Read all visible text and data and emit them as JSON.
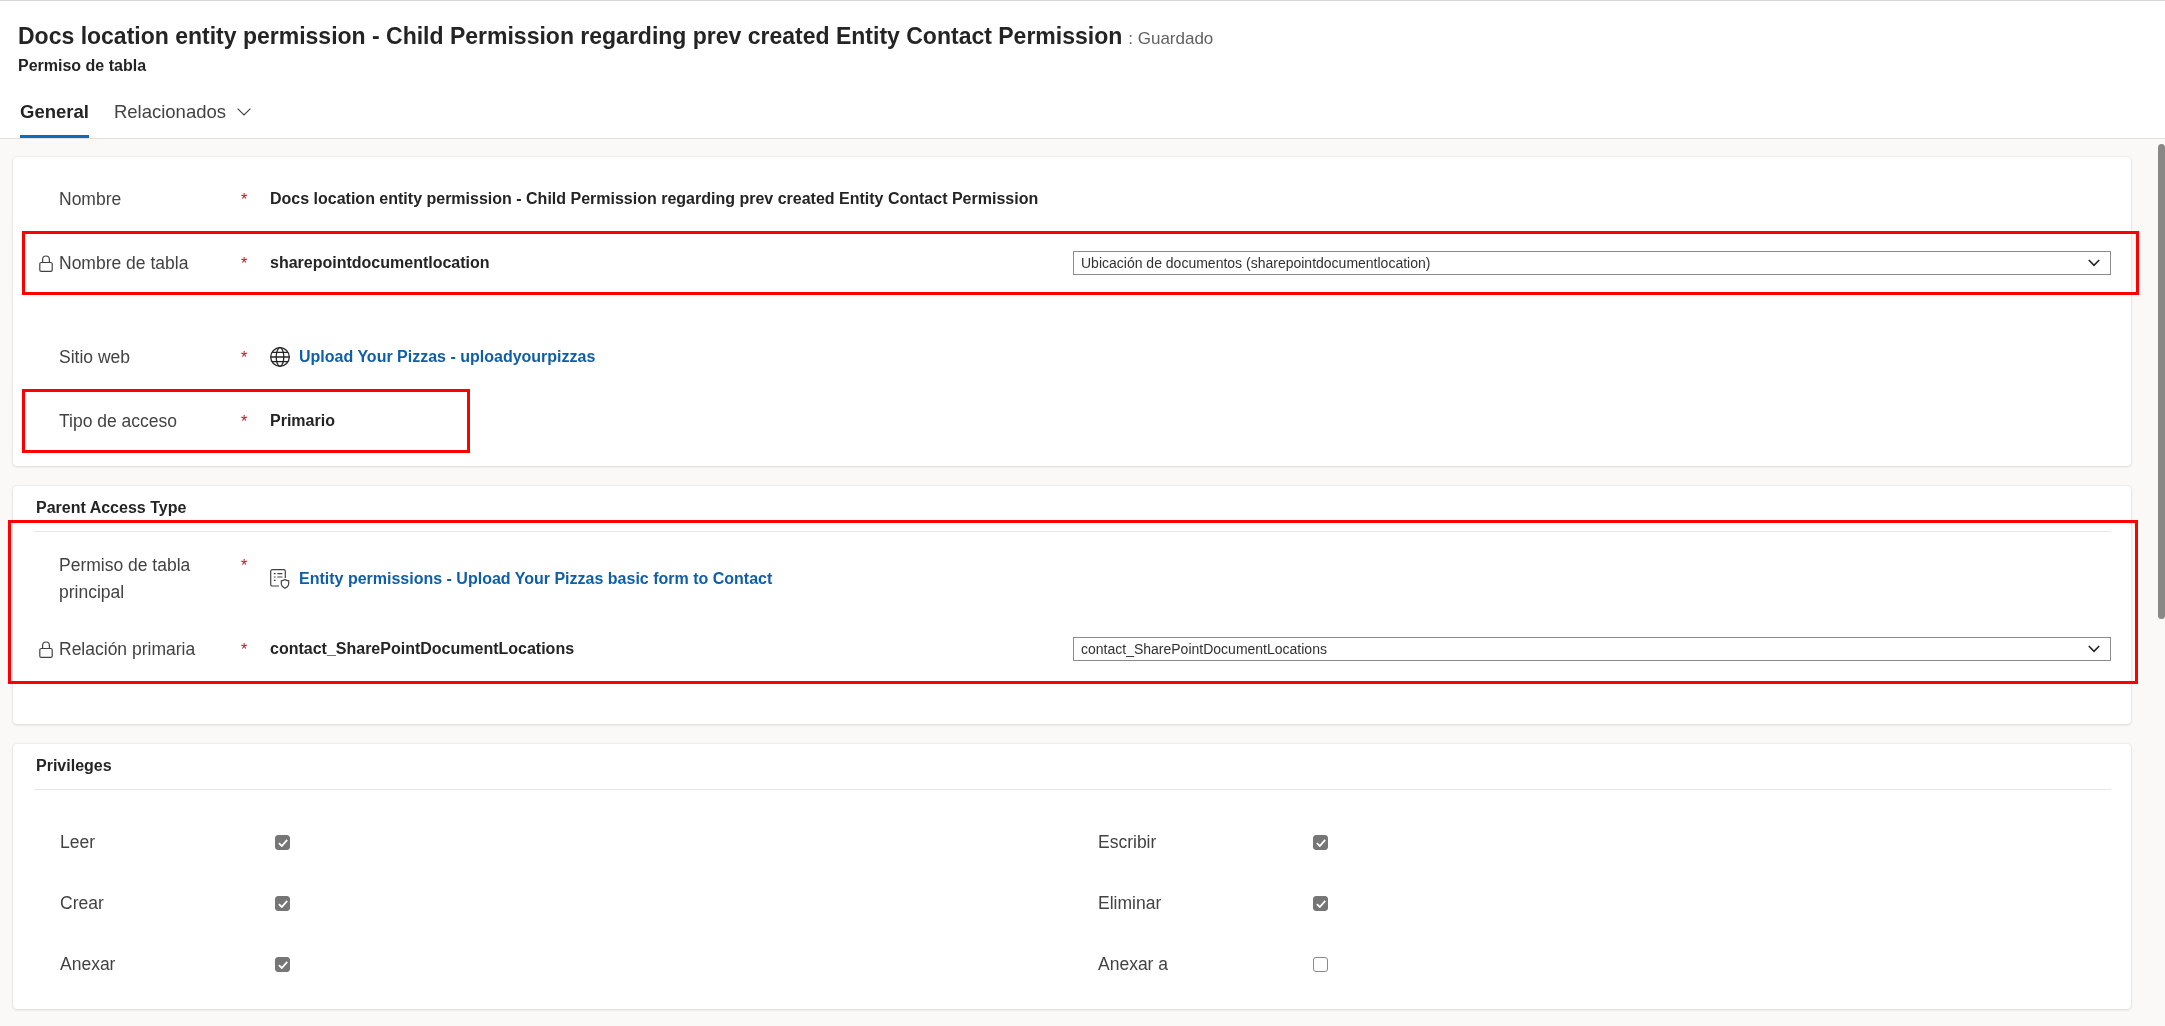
{
  "header": {
    "title": "Docs location entity permission - Child Permission regarding prev created Entity Contact Permission",
    "status": ": Guardado",
    "subtitle": "Permiso de tabla"
  },
  "tabs": [
    {
      "label": "General",
      "selected": true,
      "has_menu": false
    },
    {
      "label": "Relacionados",
      "selected": false,
      "has_menu": true
    }
  ],
  "sections": [
    {
      "kind": "form",
      "highlighted": false,
      "fields": [
        {
          "label": "Nombre",
          "required_mark": "*",
          "locked": false,
          "highlighted": false,
          "kind": "text",
          "value": "Docs location entity permission - Child Permission regarding prev created Entity Contact Permission"
        },
        {
          "label": "Nombre de tabla",
          "required_mark": "*",
          "locked": true,
          "highlighted": true,
          "kind": "select",
          "value": "sharepointdocumentlocation",
          "option": "Ubicación de documentos (sharepointdocumentlocation)"
        },
        {
          "label": "Sitio web",
          "required_mark": "*",
          "locked": false,
          "highlighted": false,
          "kind": "web-link",
          "value": "Upload Your Pizzas - uploadyourpizzas"
        },
        {
          "label": "Tipo de acceso",
          "required_mark": "*",
          "locked": false,
          "highlighted": true,
          "kind": "text",
          "value": "Primario"
        }
      ]
    },
    {
      "kind": "form",
      "title": "Parent Access Type",
      "highlighted": true,
      "fields": [
        {
          "label": "Permiso de tabla principal",
          "required_mark": "*",
          "locked": false,
          "highlighted": false,
          "kind": "record-link",
          "value": "Entity permissions - Upload Your Pizzas basic form to Contact"
        },
        {
          "label": "Relación primaria",
          "required_mark": "*",
          "locked": true,
          "highlighted": false,
          "kind": "select",
          "value": "contact_SharePointDocumentLocations",
          "option": "contact_SharePointDocumentLocations"
        }
      ]
    },
    {
      "kind": "privileges",
      "title": "Privileges",
      "highlighted": false,
      "privileges": [
        {
          "label": "Leer",
          "checked": true
        },
        {
          "label": "Escribir",
          "checked": true
        },
        {
          "label": "Crear",
          "checked": true
        },
        {
          "label": "Eliminar",
          "checked": true
        },
        {
          "label": "Anexar",
          "checked": true
        },
        {
          "label": "Anexar a",
          "checked": false
        }
      ]
    }
  ]
}
